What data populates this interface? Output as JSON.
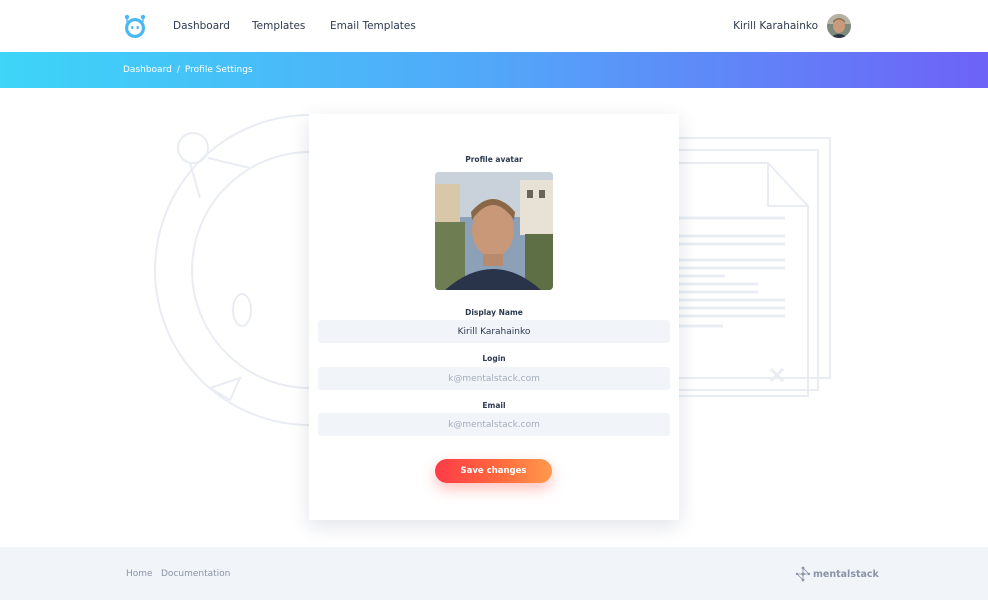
{
  "header": {
    "nav": {
      "dashboard": "Dashboard",
      "templates": "Templates",
      "email_templates": "Email Templates"
    },
    "user_name": "Kirill Karahainko"
  },
  "breadcrumb": {
    "items": [
      "Dashboard",
      "Profile Settings"
    ],
    "separator": "/"
  },
  "profile": {
    "avatar_label": "Profile avatar",
    "display_name_label": "Display Name",
    "display_name_value": "Kirill Karahainko",
    "login_label": "Login",
    "login_placeholder": "k@mentalstack.com",
    "email_label": "Email",
    "email_placeholder": "k@mentalstack.com",
    "save_label": "Save changes"
  },
  "footer": {
    "home": "Home",
    "documentation": "Documentation",
    "brand": "mentalstack"
  },
  "colors": {
    "gradient_start": "#3dd5f8",
    "gradient_end": "#6e62f7",
    "button_start": "#ff3b47",
    "button_end": "#ff9a4e",
    "logo": "#4bb8f5"
  },
  "icons": {
    "logo": "robot-logo-icon",
    "brand": "mentalstack-logo-icon"
  }
}
